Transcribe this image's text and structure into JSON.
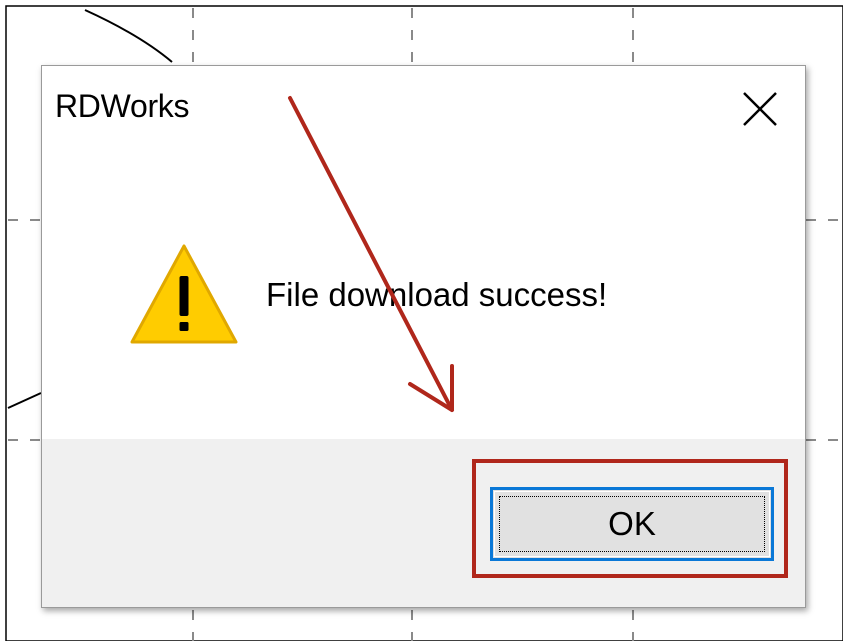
{
  "dialog": {
    "title": "RDWorks",
    "message": "File download success!",
    "ok_label": "OK"
  },
  "icons": {
    "warning": "warning-triangle-icon",
    "close": "close-icon"
  },
  "colors": {
    "annotation_red": "#b0271b",
    "focus_blue": "#0a78d7",
    "warning_yellow": "#ffcc00",
    "footer_gray": "#f0f0f0"
  }
}
